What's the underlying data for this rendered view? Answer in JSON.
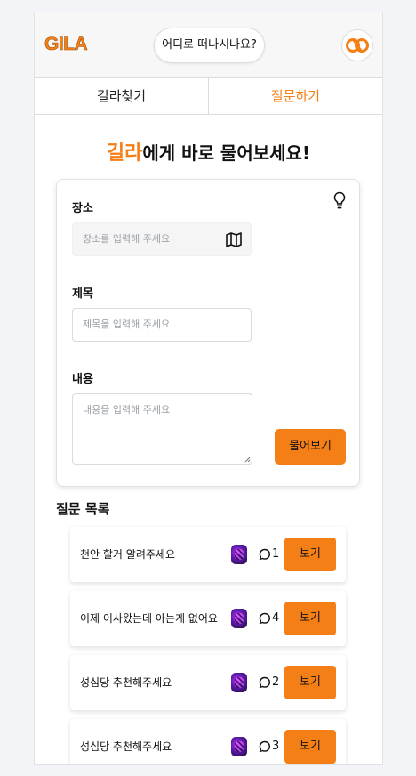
{
  "header": {
    "logo": "GILA",
    "search_placeholder": "어디로 떠나시나요?"
  },
  "tabs": [
    {
      "label": "길라찾기"
    },
    {
      "label": "질문하기"
    }
  ],
  "hero": {
    "accent": "길라",
    "rest": "에게 바로 물어보세요!"
  },
  "form": {
    "place_label": "장소",
    "place_placeholder": "장소를 입력해 주세요",
    "title_label": "제목",
    "title_placeholder": "제목을 입력해 주세요",
    "content_label": "내용",
    "content_placeholder": "내용을 입력해 주세요",
    "submit_label": "물어보기"
  },
  "questions": {
    "heading": "질문 목록",
    "items": [
      {
        "title": "천안 할거 알려주세요",
        "comments": "1",
        "button": "보기"
      },
      {
        "title": "이제 이사왔는데 아는게 없어요",
        "comments": "4",
        "button": "보기"
      },
      {
        "title": "성심당 추천해주세요",
        "comments": "2",
        "button": "보기"
      },
      {
        "title": "성심당 추천해주세요",
        "comments": "3",
        "button": "보기"
      }
    ]
  },
  "colors": {
    "accent": "#f57f17",
    "background": "#f3f4f7"
  }
}
